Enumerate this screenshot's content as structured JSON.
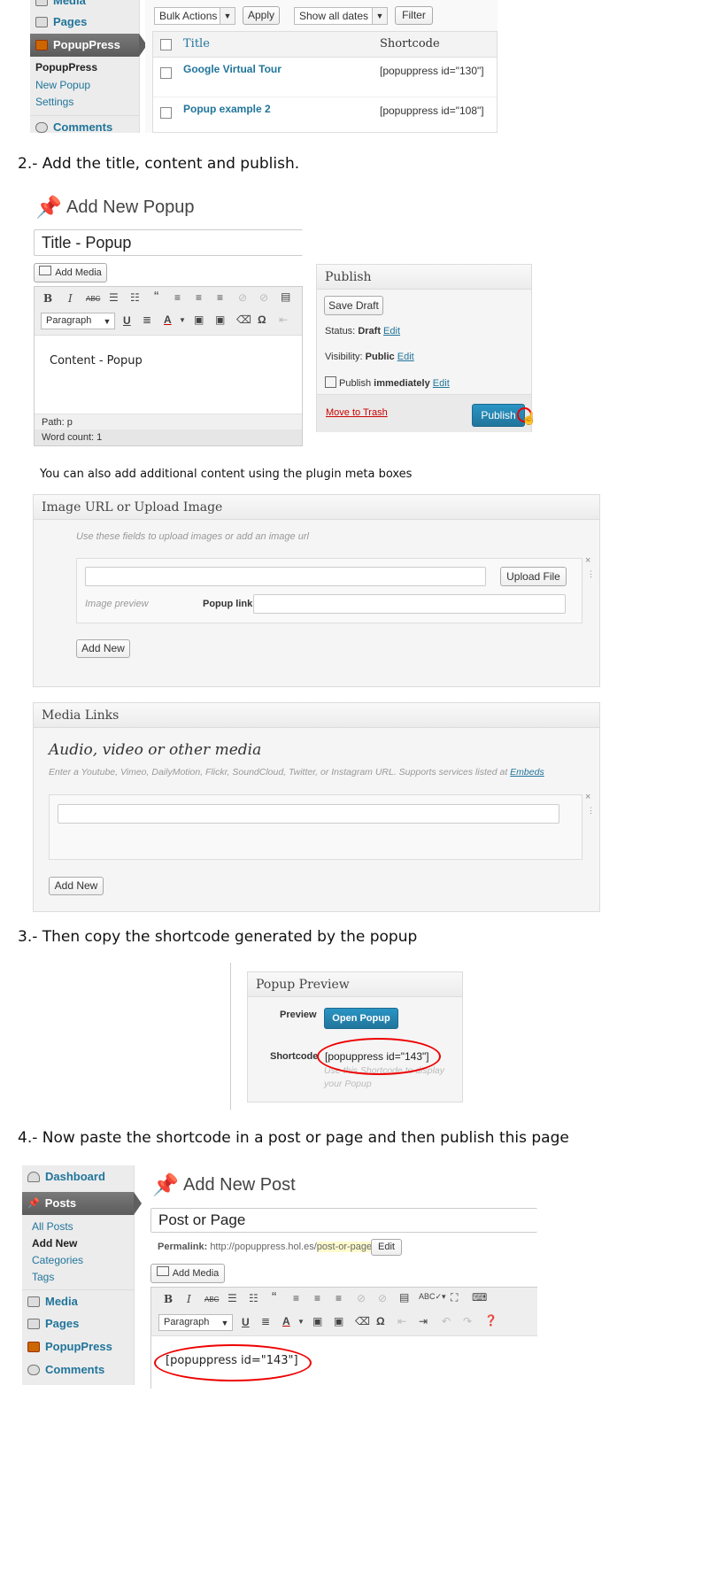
{
  "s1": {
    "sidebar": {
      "media": "Media",
      "pages": "Pages",
      "popuppress": "PopupPress",
      "sub_popuppress": "PopupPress",
      "new_popup": "New Popup",
      "settings": "Settings",
      "comments": "Comments"
    },
    "bulk_actions": "Bulk Actions",
    "apply": "Apply",
    "show_all_dates": "Show all dates",
    "filter": "Filter",
    "col_title": "Title",
    "col_shortcode": "Shortcode",
    "rows": [
      {
        "title": "Google Virtual Tour",
        "shortcode": "[popuppress id=\"130\"]"
      },
      {
        "title": "Popup example 2",
        "shortcode": "[popuppress id=\"108\"]"
      }
    ]
  },
  "step2": "2.- Add the title, content and publish.",
  "s2": {
    "heading": "Add New Popup",
    "title_value": "Title - Popup",
    "add_media": "Add Media",
    "toolbar": {
      "bold": "B",
      "italic": "I",
      "strike": "ABC",
      "quote": "“",
      "paragraph": "Paragraph",
      "underline": "U",
      "color": "A",
      "omega": "Ω"
    },
    "content": "Content - Popup",
    "path": "Path: p",
    "word_count": "Word count: 1",
    "publish": {
      "title": "Publish",
      "save_draft": "Save Draft",
      "status_label": "Status:",
      "status_value": "Draft",
      "visibility_label": "Visibility:",
      "visibility_value": "Public",
      "publish_label": "Publish",
      "publish_when": "immediately",
      "edit": "Edit",
      "trash": "Move to Trash",
      "publish_btn": "Publish"
    }
  },
  "note": "You can also add additional content using the plugin meta boxes",
  "image_box": {
    "title": "Image URL or Upload Image",
    "hint": "Use these fields to upload images or add an image url",
    "upload": "Upload File",
    "preview": "Image preview",
    "popup_link": "Popup link:",
    "add_new": "Add New",
    "x": "×"
  },
  "media_box": {
    "title": "Media Links",
    "heading": "Audio, video or other media",
    "hint": "Enter a Youtube, Vimeo, DailyMotion, Flickr, SoundCloud, Twitter, or Instagram URL. Supports services listed at",
    "hint_link": "Embeds",
    "add_new": "Add New",
    "x": "×"
  },
  "step3": "3.- Then copy the shortcode generated by the popup",
  "preview_box": {
    "title": "Popup Preview",
    "preview_label": "Preview",
    "open_btn": "Open Popup",
    "shortcode_label": "Shortcode",
    "shortcode": "[popuppress id=\"143\"]",
    "hint": "Use this Shortcode to display your Popup"
  },
  "step4": "4.- Now paste the shortcode in a post or page and then publish this page",
  "s4": {
    "sidebar": {
      "dashboard": "Dashboard",
      "posts": "Posts",
      "all_posts": "All Posts",
      "add_new": "Add New",
      "categories": "Categories",
      "tags": "Tags",
      "media": "Media",
      "pages": "Pages",
      "popuppress": "PopupPress",
      "comments": "Comments"
    },
    "heading": "Add New Post",
    "title_value": "Post or Page",
    "permalink_label": "Permalink:",
    "permalink_base": "http://popuppress.hol.es/",
    "permalink_slug": "post-or-page",
    "permalink_end": "/",
    "edit": "Edit",
    "add_media": "Add Media",
    "toolbar": {
      "bold": "B",
      "italic": "I",
      "strike": "ABC",
      "quote": "“",
      "paragraph": "Paragraph",
      "underline": "U",
      "color": "A",
      "omega": "Ω"
    },
    "content": "[popuppress id=\"143\"]"
  }
}
